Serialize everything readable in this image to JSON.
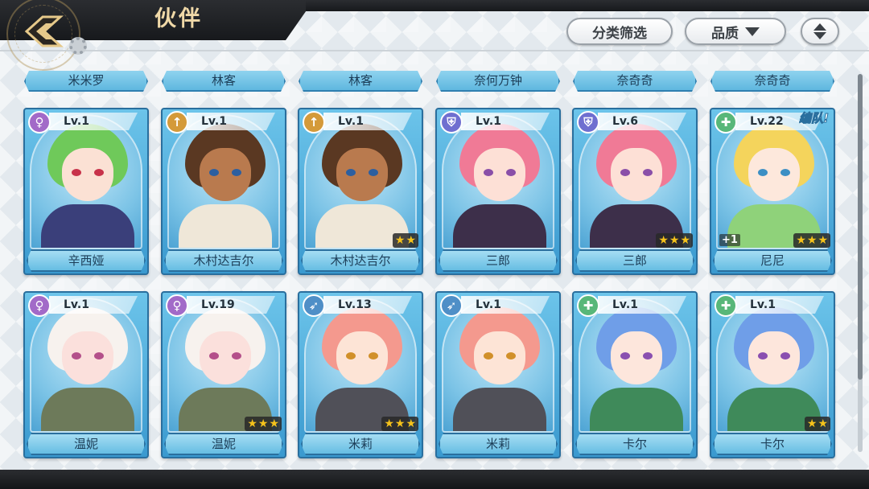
{
  "header": {
    "title": "伙伴"
  },
  "toolbar": {
    "filter_label": "分类筛选",
    "quality_label": "品质"
  },
  "partial_row": [
    "米米罗",
    "林客",
    "林客",
    "奈何万钟",
    "奈奇奇",
    "奈奇奇"
  ],
  "cards": [
    {
      "name": "辛西娅",
      "level": "Lv.1",
      "class_icon": "mage-class-icon",
      "stars": 0,
      "tag": "",
      "plus": ""
    },
    {
      "name": "木村达吉尔",
      "level": "Lv.1",
      "class_icon": "warrior-class-icon",
      "stars": 0,
      "tag": "",
      "plus": ""
    },
    {
      "name": "木村达吉尔",
      "level": "Lv.1",
      "class_icon": "warrior-class-icon",
      "stars": 2,
      "tag": "",
      "plus": ""
    },
    {
      "name": "三郎",
      "level": "Lv.1",
      "class_icon": "guard-class-icon",
      "stars": 0,
      "tag": "",
      "plus": ""
    },
    {
      "name": "三郎",
      "level": "Lv.6",
      "class_icon": "guard-class-icon",
      "stars": 3,
      "tag": "",
      "plus": ""
    },
    {
      "name": "尼尼",
      "level": "Lv.22",
      "class_icon": "healer-class-icon",
      "stars": 3,
      "tag": "编队!",
      "plus": "+1"
    },
    {
      "name": "温妮",
      "level": "Lv.1",
      "class_icon": "mage-class-icon",
      "stars": 0,
      "tag": "",
      "plus": ""
    },
    {
      "name": "温妮",
      "level": "Lv.19",
      "class_icon": "mage-class-icon",
      "stars": 3,
      "tag": "",
      "plus": ""
    },
    {
      "name": "米莉",
      "level": "Lv.13",
      "class_icon": "archer-class-icon",
      "stars": 3,
      "tag": "",
      "plus": ""
    },
    {
      "name": "米莉",
      "level": "Lv.1",
      "class_icon": "archer-class-icon",
      "stars": 0,
      "tag": "",
      "plus": ""
    },
    {
      "name": "卡尔",
      "level": "Lv.1",
      "class_icon": "healer-class-icon",
      "stars": 0,
      "tag": "",
      "plus": ""
    },
    {
      "name": "卡尔",
      "level": "Lv.1",
      "class_icon": "healer-class-icon",
      "stars": 2,
      "tag": "",
      "plus": ""
    }
  ],
  "colors": {
    "header_dark": "#1d1f22",
    "title_gold": "#f0d9a8",
    "card_blue": "#3a99cf",
    "star_gold": "#f5c21b"
  }
}
